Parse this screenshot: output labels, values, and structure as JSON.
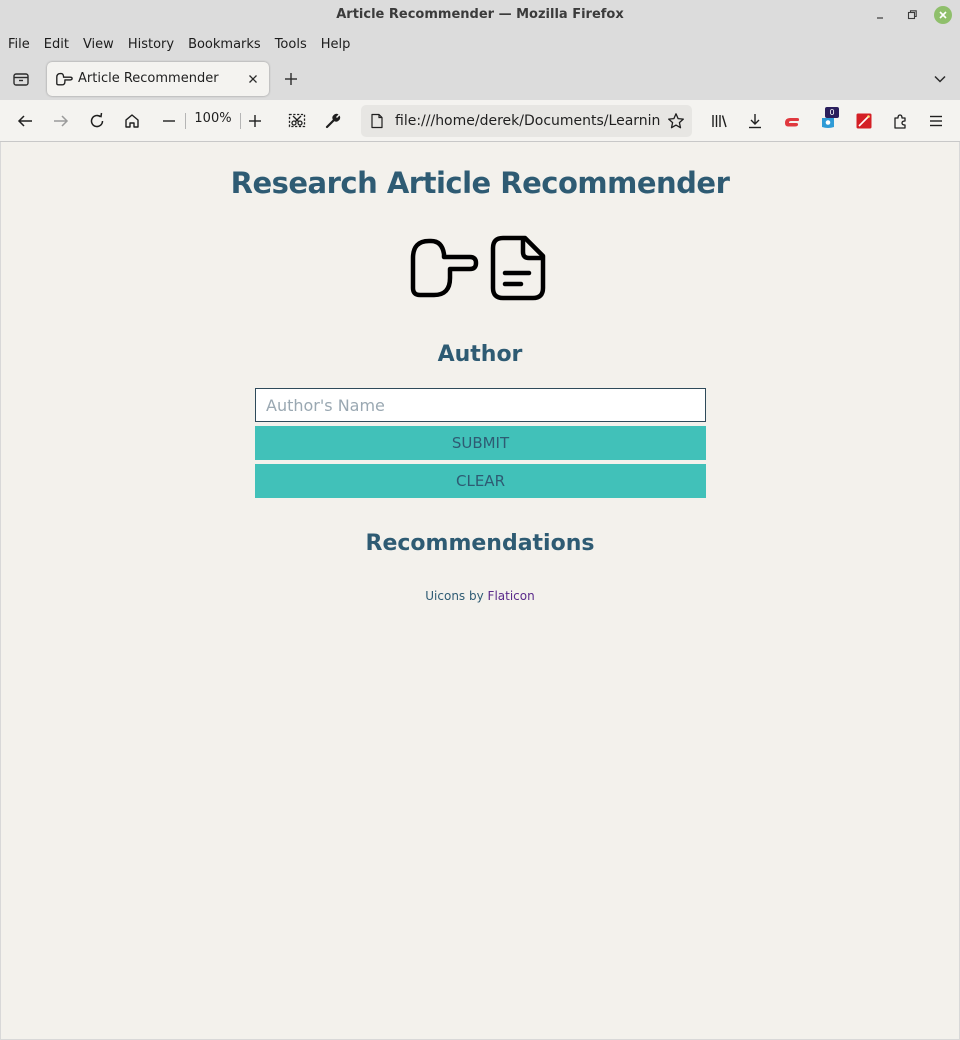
{
  "window": {
    "title": "Article Recommender — Mozilla Firefox"
  },
  "menu": [
    "File",
    "Edit",
    "View",
    "History",
    "Bookmarks",
    "Tools",
    "Help"
  ],
  "tab": {
    "title": "Article Recommender"
  },
  "navbar": {
    "zoom": "100%",
    "url": "file:///home/derek/Documents/Learning/L",
    "badge_count": "0"
  },
  "page": {
    "title": "Research Article Recommender",
    "author_heading": "Author",
    "author_input": {
      "placeholder": "Author's Name",
      "value": ""
    },
    "submit_label": "SUBMIT",
    "clear_label": "CLEAR",
    "recommendations_heading": "Recommendations",
    "credit_prefix": "Uicons by",
    "credit_link": "Flaticon"
  },
  "colors": {
    "heading": "#2e5b73",
    "button_bg": "#41c1b9",
    "page_bg": "#f3f1ec",
    "link": "#5a2a8a"
  },
  "icons": [
    "list-all-tabs-icon",
    "hand-pointing-icon",
    "close-icon",
    "plus-icon",
    "chevron-down-icon",
    "back-icon",
    "forward-icon",
    "reload-icon",
    "home-icon",
    "zoom-out-icon",
    "zoom-in-icon",
    "screenshot-icon",
    "wrench-icon",
    "page-icon",
    "star-icon",
    "library-icon",
    "download-icon",
    "extension-icon",
    "menu-icon",
    "document-icon"
  ]
}
